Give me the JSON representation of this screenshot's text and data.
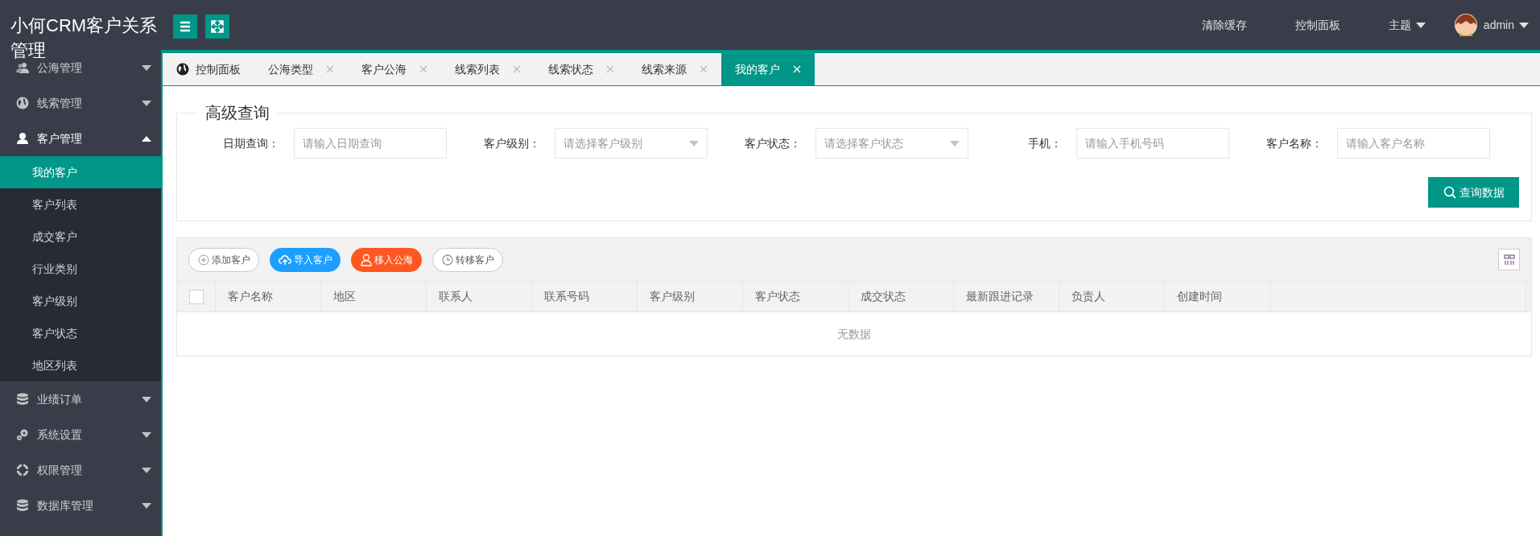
{
  "header": {
    "title": "小何CRM客户关系管理",
    "nav": [
      {
        "label": "清除缓存",
        "has_menu": false
      },
      {
        "label": "控制面板",
        "has_menu": false
      },
      {
        "label": "主题",
        "has_menu": true
      }
    ],
    "user": {
      "name": "admin",
      "has_menu": true
    }
  },
  "sidebar": {
    "items": [
      {
        "label": "公海管理",
        "expanded": false
      },
      {
        "label": "线索管理",
        "expanded": false
      },
      {
        "label": "客户管理",
        "expanded": true,
        "children": [
          {
            "label": "我的客户",
            "selected": true
          },
          {
            "label": "客户列表",
            "selected": false
          },
          {
            "label": "成交客户",
            "selected": false
          },
          {
            "label": "行业类别",
            "selected": false
          },
          {
            "label": "客户级别",
            "selected": false
          },
          {
            "label": "客户状态",
            "selected": false
          },
          {
            "label": "地区列表",
            "selected": false
          }
        ]
      },
      {
        "label": "业绩订单",
        "expanded": false
      },
      {
        "label": "系统设置",
        "expanded": false
      },
      {
        "label": "权限管理",
        "expanded": false
      },
      {
        "label": "数据库管理",
        "expanded": false
      }
    ]
  },
  "tabs": [
    {
      "label": "控制面板",
      "closable": false,
      "selected": false
    },
    {
      "label": "公海类型",
      "closable": true,
      "selected": false
    },
    {
      "label": "客户公海",
      "closable": true,
      "selected": false
    },
    {
      "label": "线索列表",
      "closable": true,
      "selected": false
    },
    {
      "label": "线索状态",
      "closable": true,
      "selected": false
    },
    {
      "label": "线索来源",
      "closable": true,
      "selected": false
    },
    {
      "label": "我的客户",
      "closable": true,
      "selected": true
    }
  ],
  "search": {
    "title": "高级查询",
    "filters": [
      {
        "label": "日期查询：",
        "kind": "input",
        "placeholder": "请输入日期查询"
      },
      {
        "label": "客户级别：",
        "kind": "select",
        "placeholder": "请选择客户级别"
      },
      {
        "label": "客户状态：",
        "kind": "select",
        "placeholder": "请选择客户状态"
      },
      {
        "label": "手机：",
        "kind": "input",
        "placeholder": "请输入手机号码"
      },
      {
        "label": "客户名称：",
        "kind": "input",
        "placeholder": "请输入客户名称"
      }
    ],
    "button": "查询数据"
  },
  "toolbar": [
    {
      "label": "添加客户",
      "kind": "plain"
    },
    {
      "label": "导入客户",
      "kind": "primary"
    },
    {
      "label": "移入公海",
      "kind": "warning"
    },
    {
      "label": "转移客户",
      "kind": "plain"
    }
  ],
  "table": {
    "select_all": {
      "checked": false
    },
    "columns": [
      "客户名称",
      "地区",
      "联系人",
      "联系号码",
      "客户级别",
      "客户状态",
      "成交状态",
      "最新跟进记录",
      "负责人",
      "创建时间"
    ],
    "empty_text": "无数据"
  }
}
